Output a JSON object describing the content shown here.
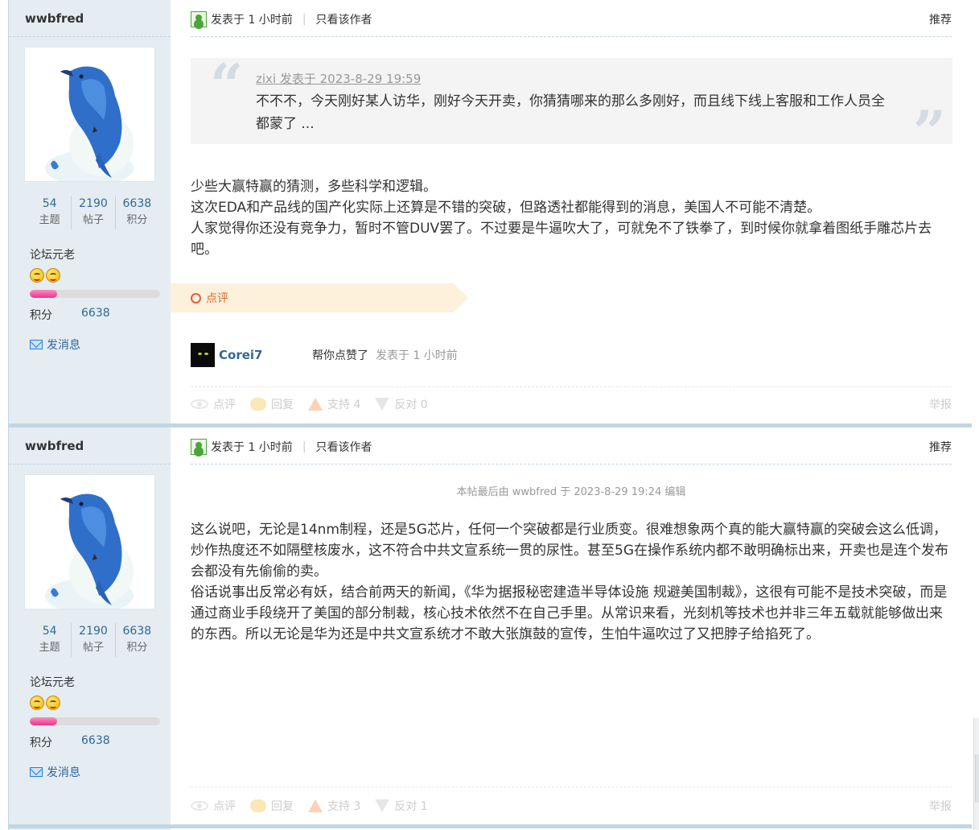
{
  "posts": [
    {
      "user": {
        "name": "wwbfred",
        "stats": [
          {
            "num": "54",
            "label": "主题"
          },
          {
            "num": "2190",
            "label": "帖子"
          },
          {
            "num": "6638",
            "label": "积分"
          }
        ],
        "rank": "论坛元老",
        "rank_progress": 0.21,
        "credit_label": "积分",
        "credit_value": "6638",
        "message_label": "发消息"
      },
      "header": {
        "posted": "发表于 1 小时前",
        "only_author": "只看该作者",
        "recommend": "推荐"
      },
      "quote": {
        "author": "zixi 发表于 2023-8-29 19:59",
        "text": "不不不，今天刚好某人访华，刚好今天开卖，你猜猜哪来的那么多刚好，而且线下线上客服和工作人员全都蒙了 ..."
      },
      "content": [
        "少些大赢特赢的猜测，多些科学和逻辑。",
        "这次EDA和产品线的国产化实际上还算是不错的突破，但路透社都能得到的消息，美国人不可能不清楚。",
        "人家觉得你还没有竞争力，暂时不管DUV罢了。不过要是牛逼吹大了，可就免不了铁拳了，到时候你就拿着图纸手雕芯片去吧。"
      ],
      "dianping": "点评",
      "comment": {
        "user": "Corei7",
        "text": "帮你点赞了",
        "time": "发表于 1 小时前"
      },
      "footer": {
        "review": "点评",
        "reply": "回复",
        "support": "支持 4",
        "oppose": "反对 0",
        "report": "举报"
      }
    },
    {
      "user": {
        "name": "wwbfred",
        "stats": [
          {
            "num": "54",
            "label": "主题"
          },
          {
            "num": "2190",
            "label": "帖子"
          },
          {
            "num": "6638",
            "label": "积分"
          }
        ],
        "rank": "论坛元老",
        "rank_progress": 0.21,
        "credit_label": "积分",
        "credit_value": "6638",
        "message_label": "发消息"
      },
      "header": {
        "posted": "发表于 1 小时前",
        "only_author": "只看该作者",
        "recommend": "推荐"
      },
      "edit_note": "本帖最后由 wwbfred 于 2023-8-29 19:24 编辑",
      "content": [
        "这么说吧，无论是14nm制程，还是5G芯片，任何一个突破都是行业质变。很难想象两个真的能大赢特赢的突破会这么低调，炒作热度还不如隔壁核废水，这不符合中共文宣系统一贯的尿性。甚至5G在操作系统内都不敢明确标出来，开卖也是连个发布会都没有先偷偷的卖。",
        "俗话说事出反常必有妖，结合前两天的新闻，《华为据报秘密建造半导体设施 规避美国制裁》，这很有可能不是技术突破，而是通过商业手段绕开了美国的部分制裁，核心技术依然不在自己手里。从常识来看，光刻机等技术也并非三年五载就能够做出来的东西。所以无论是华为还是中共文宣系统才不敢大张旗鼓的宣传，生怕牛逼吹过了又把脖子给掐死了。"
      ],
      "footer": {
        "review": "点评",
        "reply": "回复",
        "support": "支持 3",
        "oppose": "反对 1",
        "report": "举报"
      }
    }
  ]
}
